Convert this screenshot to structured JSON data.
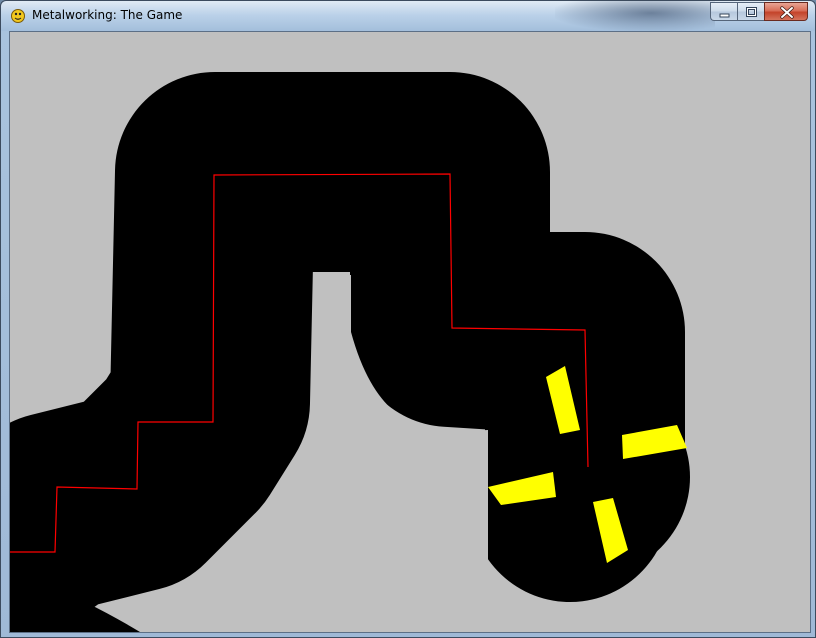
{
  "window": {
    "title": "Metalworking: The Game",
    "app_icon": "python-snake-icon"
  },
  "caption_buttons": {
    "minimize_icon": "minimize-icon",
    "maximize_icon": "maximize-icon",
    "close_icon": "close-icon"
  },
  "game": {
    "background_color": "#c0c0c0",
    "metal_color": "#000000",
    "path_color": "#ff0000",
    "blade_color": "#ffff00"
  }
}
